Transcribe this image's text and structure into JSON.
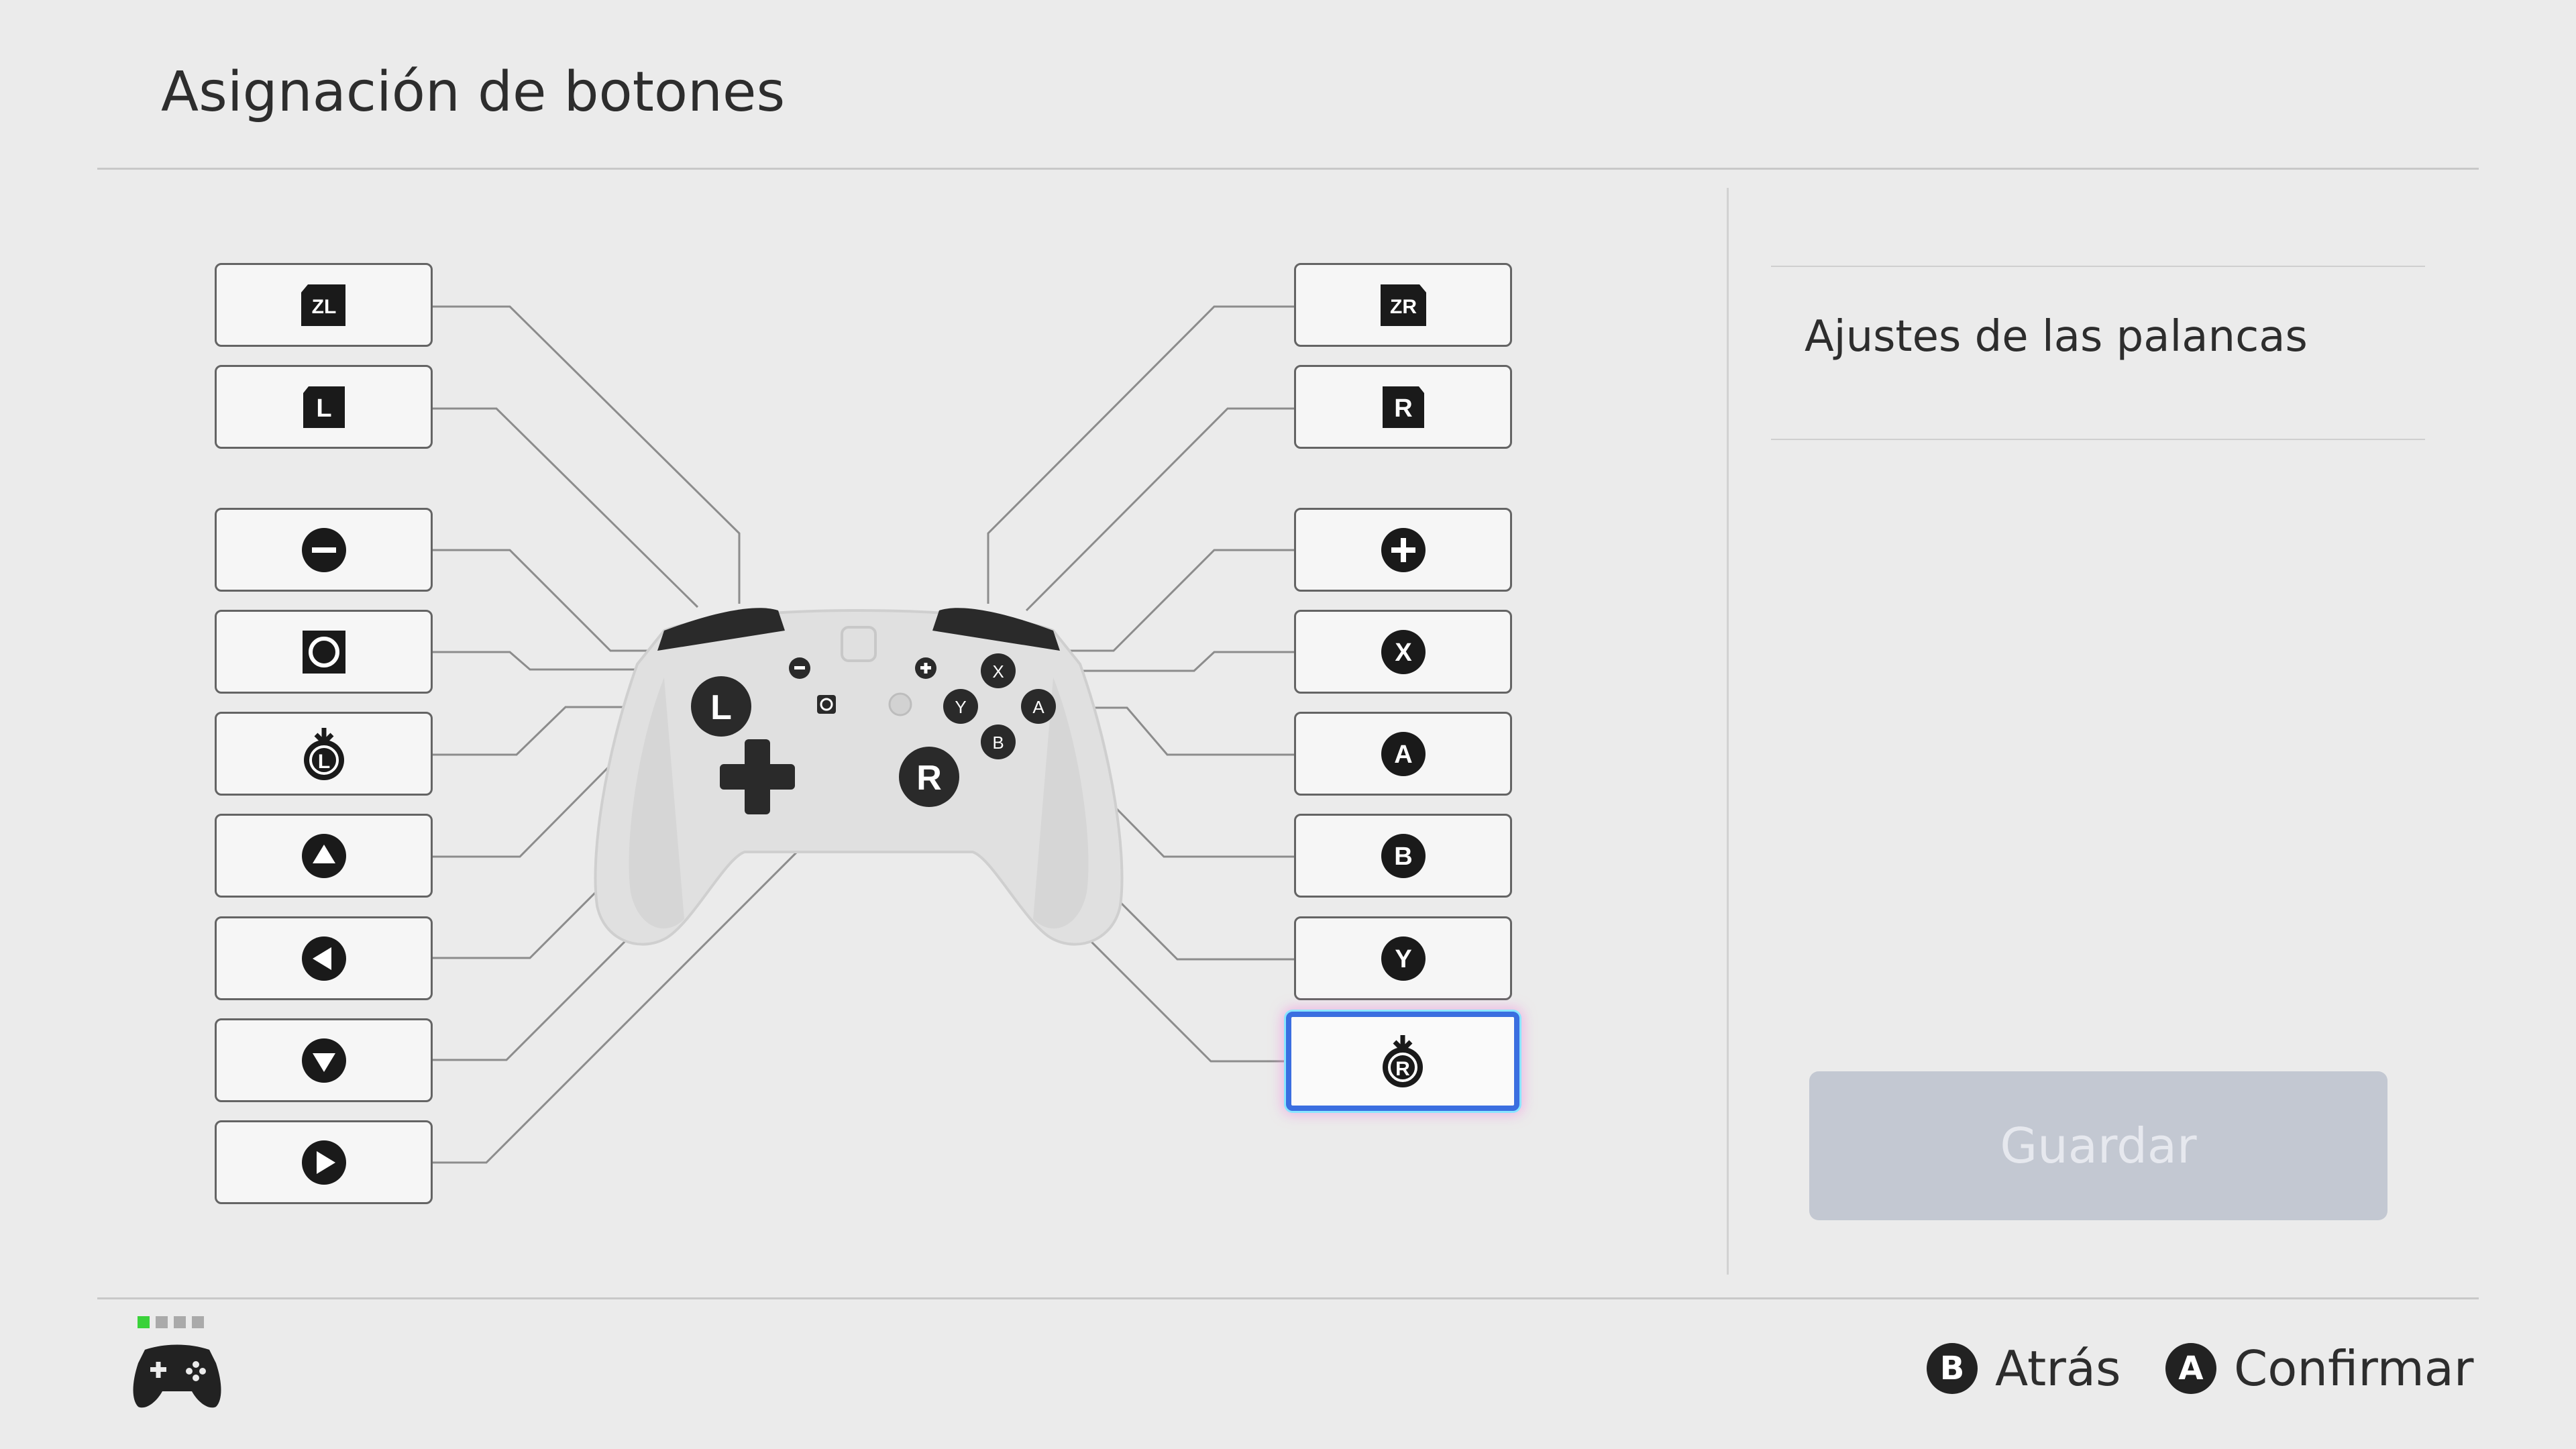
{
  "header": {
    "title": "Asignación de botones"
  },
  "left_buttons": [
    {
      "label": "ZL",
      "icon": "zl-button-icon"
    },
    {
      "label": "L",
      "icon": "l-button-icon"
    },
    {
      "label": "−",
      "icon": "minus-button-icon"
    },
    {
      "label": "",
      "icon": "capture-button-icon"
    },
    {
      "label": "L",
      "icon": "left-stick-press-icon"
    },
    {
      "label": "",
      "icon": "dpad-up-icon"
    },
    {
      "label": "",
      "icon": "dpad-left-icon"
    },
    {
      "label": "",
      "icon": "dpad-down-icon"
    },
    {
      "label": "",
      "icon": "dpad-right-icon"
    }
  ],
  "right_buttons": [
    {
      "label": "ZR",
      "icon": "zr-button-icon"
    },
    {
      "label": "R",
      "icon": "r-button-icon"
    },
    {
      "label": "+",
      "icon": "plus-button-icon"
    },
    {
      "label": "X",
      "icon": "x-button-icon"
    },
    {
      "label": "A",
      "icon": "a-button-icon"
    },
    {
      "label": "B",
      "icon": "b-button-icon"
    },
    {
      "label": "Y",
      "icon": "y-button-icon"
    },
    {
      "label": "R",
      "icon": "right-stick-press-icon",
      "selected": true
    }
  ],
  "controller": {
    "left_stick": "L",
    "right_stick": "R",
    "face": {
      "x": "X",
      "y": "Y",
      "a": "A",
      "b": "B"
    }
  },
  "side_panel": {
    "stick_settings": "Ajustes de las palancas",
    "save_label": "Guardar"
  },
  "footer": {
    "back": {
      "key": "B",
      "label": "Atrás"
    },
    "confirm": {
      "key": "A",
      "label": "Confirmar"
    },
    "player_indicator": [
      true,
      false,
      false,
      false
    ]
  },
  "colors": {
    "background": "#ebebeb",
    "selection": "#3a6ee0",
    "save_disabled": "#c3c8d2",
    "player_on": "#3ad23a"
  }
}
